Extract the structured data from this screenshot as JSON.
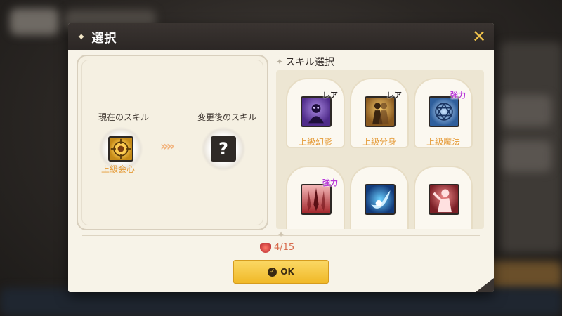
{
  "dialog": {
    "title": "選択",
    "close_icon": "close-x-icon"
  },
  "left": {
    "current_label": "現在のスキル",
    "after_label": "変更後のスキル",
    "current_name": "上級会心",
    "unknown_symbol": "?",
    "arrows": "»»»"
  },
  "right": {
    "title": "スキル選択",
    "skills": [
      {
        "name": "上級幻影",
        "tag": "レア"
      },
      {
        "name": "上級分身",
        "tag": "レア"
      },
      {
        "name": "上級魔法",
        "tag": "強力"
      },
      {
        "name": "",
        "tag": "強力"
      },
      {
        "name": "",
        "tag": ""
      },
      {
        "name": "",
        "tag": ""
      }
    ]
  },
  "footer": {
    "cost": "4/15",
    "ok_label": "OK"
  },
  "colors": {
    "accent": "#f0b928",
    "skill_name": "#e59b38",
    "strong_tag": "#b93ad5",
    "header": "#2c2725"
  }
}
